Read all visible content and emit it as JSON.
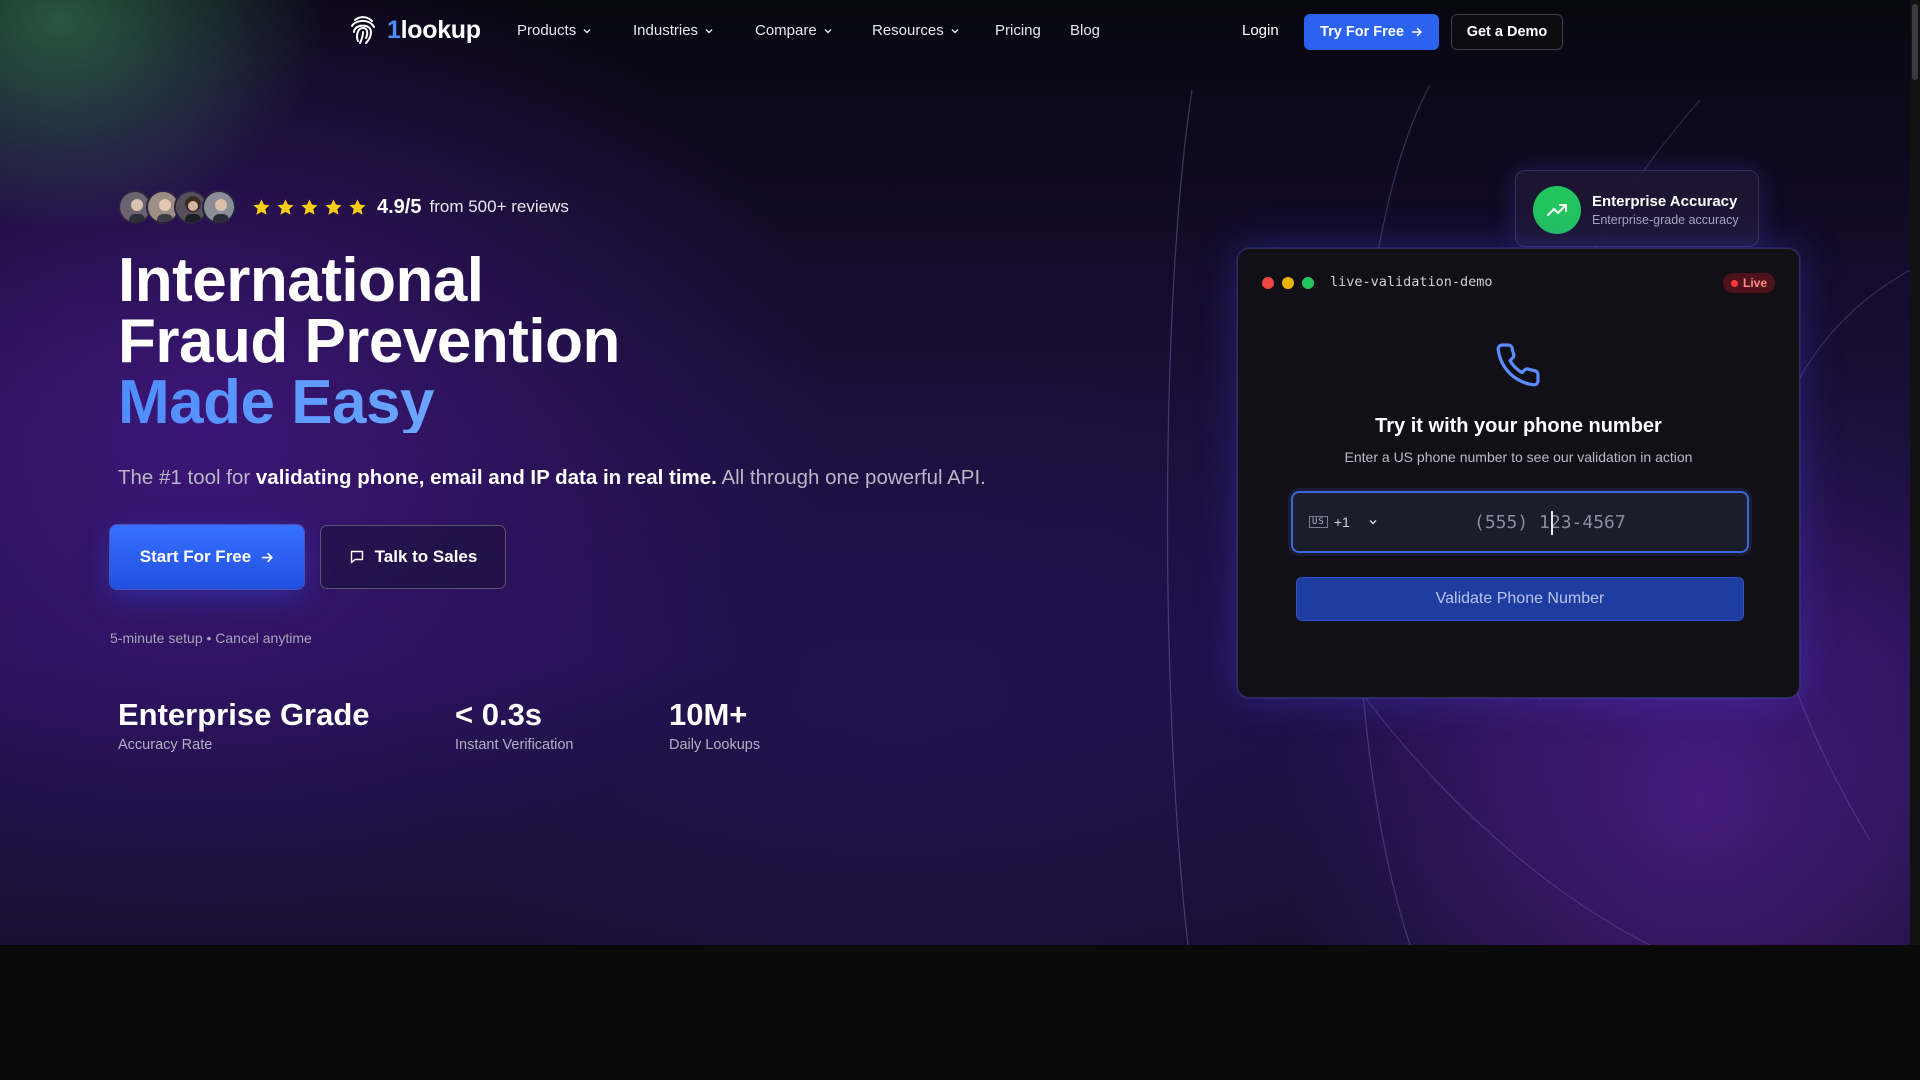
{
  "brand": {
    "logo_prefix": "1",
    "logo_suffix": "lookup"
  },
  "nav": {
    "items": [
      {
        "label": "Products",
        "dropdown": true
      },
      {
        "label": "Industries",
        "dropdown": true
      },
      {
        "label": "Compare",
        "dropdown": true
      },
      {
        "label": "Resources",
        "dropdown": true
      },
      {
        "label": "Pricing",
        "dropdown": false
      },
      {
        "label": "Blog",
        "dropdown": false
      }
    ],
    "login": "Login",
    "try_free": "Try For Free",
    "get_demo": "Get a Demo"
  },
  "hero": {
    "rating_score": "4.9/5",
    "rating_text": "from 500+ reviews",
    "stars": 5,
    "title_line1": "International",
    "title_line2": "Fraud Prevention",
    "title_line3": "Made Easy",
    "subtitle_pre": "The #1 tool for ",
    "subtitle_bold": "validating phone, email and IP data in real time.",
    "subtitle_post": " All through one powerful API.",
    "cta_primary": "Start For Free",
    "cta_secondary": "Talk to Sales",
    "setup_note": "5-minute setup • Cancel anytime",
    "stats": [
      {
        "value": "Enterprise Grade",
        "label": "Accuracy Rate"
      },
      {
        "value": "< 0.3s",
        "label": "Instant Verification"
      },
      {
        "value": "10M+",
        "label": "Daily Lookups"
      }
    ]
  },
  "badge": {
    "title": "Enterprise Accuracy",
    "subtitle": "Enterprise-grade accuracy"
  },
  "demo": {
    "window_title": "live-validation-demo",
    "live_label": "Live",
    "heading": "Try it with your phone number",
    "subheading": "Enter a US phone number to see our validation in action",
    "country_flag": "US",
    "country_code": "+1",
    "phone_placeholder": "(555) 123-4567",
    "validate_label": "Validate Phone Number"
  },
  "colors": {
    "accent": "#2b62f0",
    "title_accent": "#5b9bff",
    "success": "#22c55e",
    "star": "#facc15"
  }
}
